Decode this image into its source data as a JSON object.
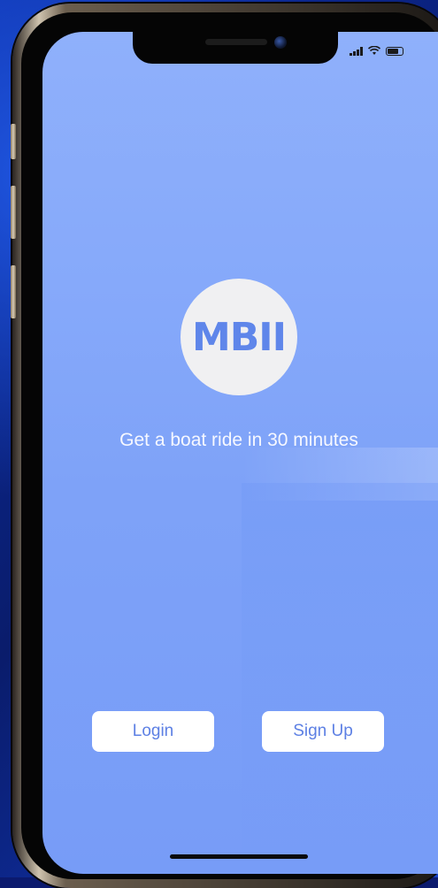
{
  "status_bar": {
    "signal_icon": "signal-bars-icon",
    "wifi_icon": "wifi-icon",
    "battery_icon": "battery-icon"
  },
  "splash": {
    "logo_text": "MBII",
    "tagline": "Get a boat ride in 30 minutes"
  },
  "actions": {
    "login_label": "Login",
    "signup_label": "Sign Up"
  },
  "colors": {
    "screen_background": "#86a9fa",
    "logo_circle": "#f0f0f2",
    "logo_text": "#5f86ea",
    "button_background": "#ffffff",
    "button_text": "#5d80e4",
    "tagline_text": "#f6f8ff"
  }
}
